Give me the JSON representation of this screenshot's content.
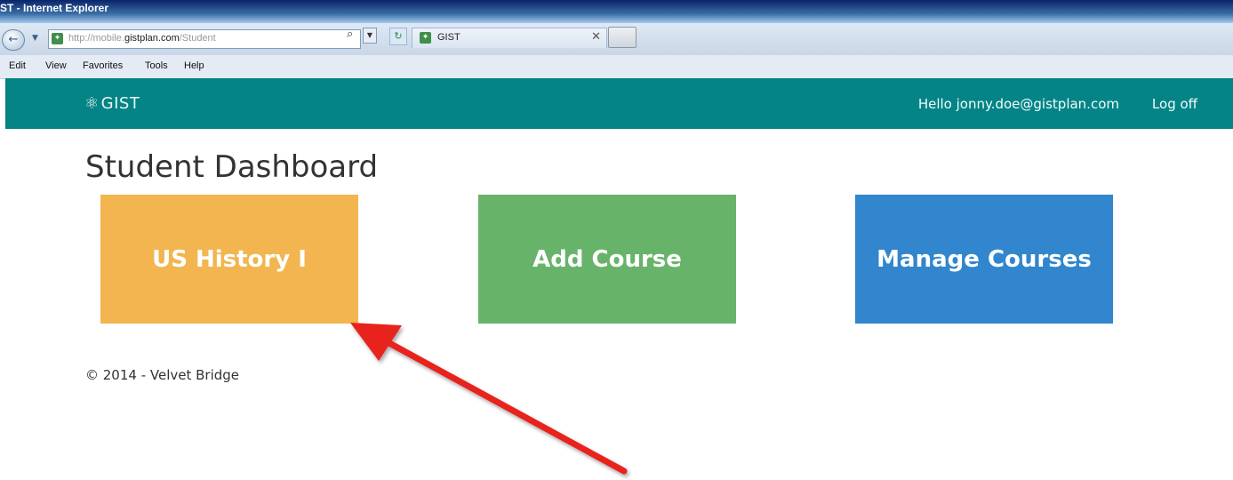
{
  "window": {
    "title": "ST - Internet Explorer"
  },
  "browser": {
    "address_prefix": "http://mobile.",
    "address_domain": "gistplan.com",
    "address_path": "/Student",
    "tab_label": "GIST",
    "menu": [
      "Edit",
      "View",
      "Favorites",
      "Tools",
      "Help"
    ]
  },
  "navbar": {
    "brand": "GIST",
    "greeting": "Hello jonny.doe@gistplan.com",
    "logoff": "Log off"
  },
  "page": {
    "title": "Student Dashboard",
    "tiles": [
      {
        "label": "US History I",
        "color": "#f2b550"
      },
      {
        "label": "Add Course",
        "color": "#68b36a"
      },
      {
        "label": "Manage Courses",
        "color": "#3186cd"
      }
    ],
    "footer": "© 2014 - Velvet Bridge"
  },
  "colors": {
    "navbar_bg": "#048486",
    "annotation_arrow": "#e8201c"
  },
  "icons": {
    "back": "back-icon",
    "search": "search-icon",
    "refresh": "refresh-icon",
    "brand": "atom-icon"
  }
}
